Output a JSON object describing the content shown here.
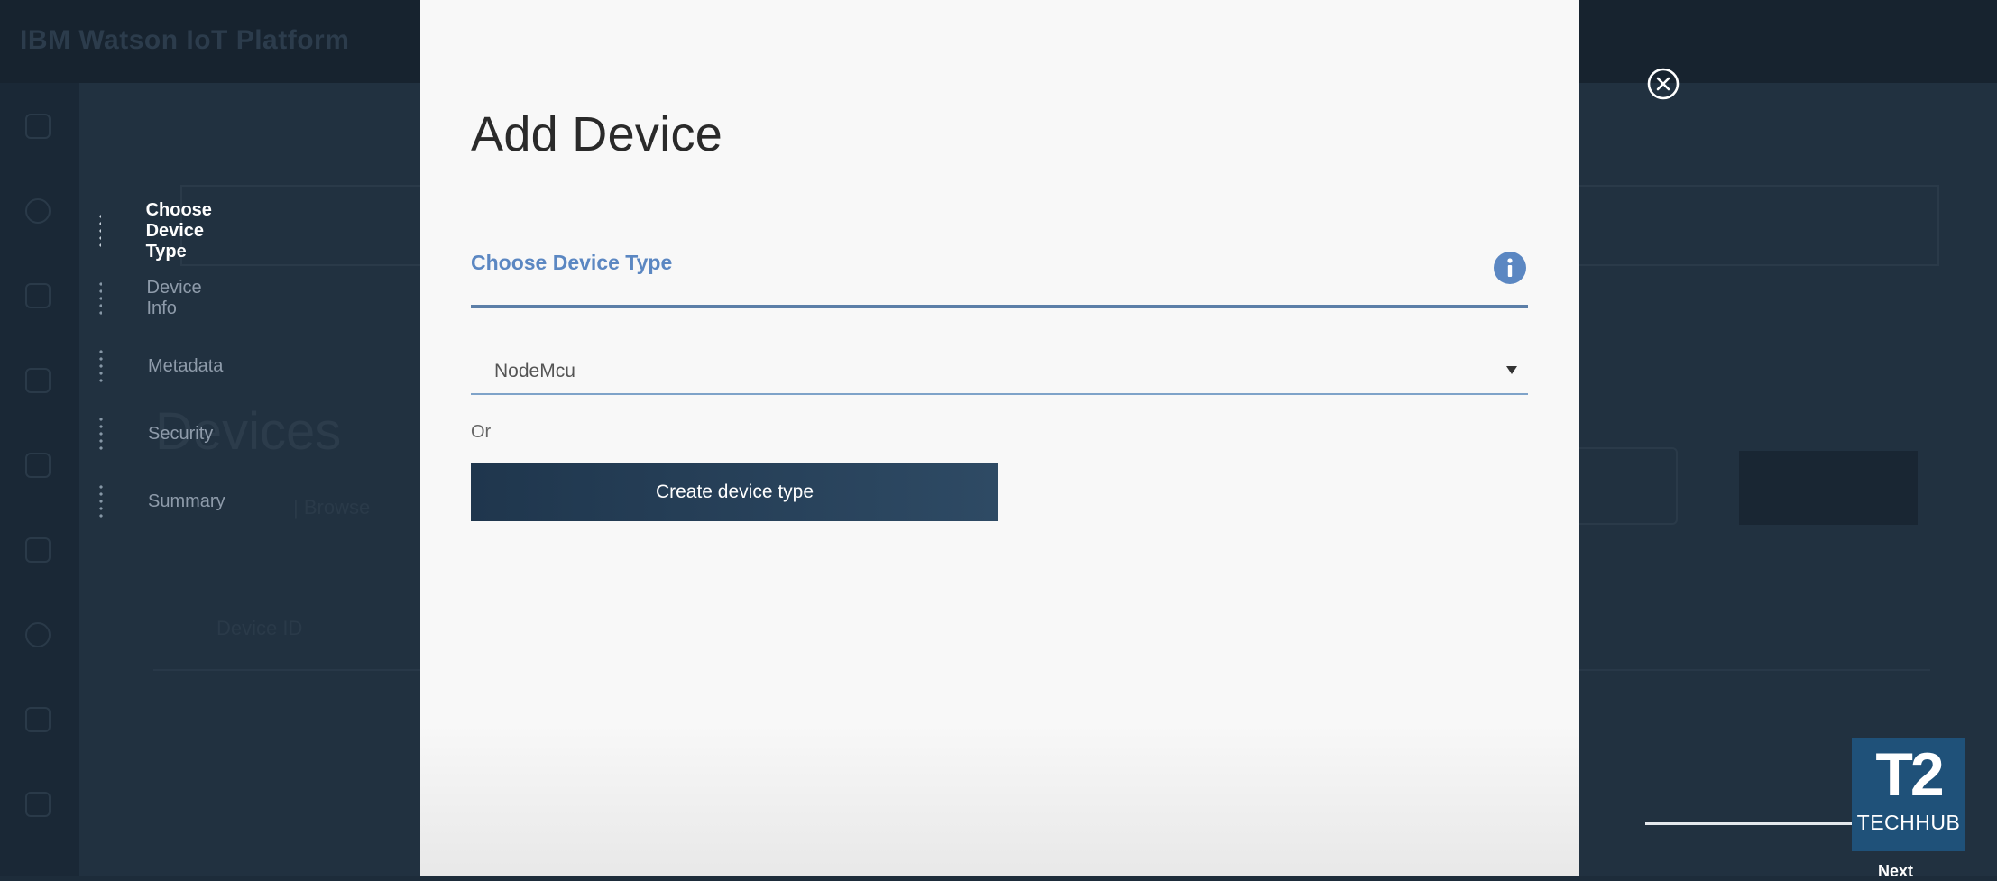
{
  "background": {
    "brand": "IBM Watson IoT Platform",
    "account": [
      "",
      ""
    ],
    "page_title": "Devices",
    "tab": "| Browse",
    "column": "Device ID"
  },
  "wizard_steps": [
    {
      "label": "Choose Device Type",
      "active": true
    },
    {
      "label": "Device Info",
      "active": false
    },
    {
      "label": "Metadata",
      "active": false
    },
    {
      "label": "Security",
      "active": false
    },
    {
      "label": "Summary",
      "active": false
    }
  ],
  "modal": {
    "title": "Add Device",
    "section_title": "Choose Device Type",
    "device_type_select": {
      "value": "NodeMcu"
    },
    "or_label": "Or",
    "create_button": "Create device type"
  },
  "footer": {
    "next_label": "Next"
  },
  "watermark": {
    "big": "T2",
    "small": "TECHHUB"
  },
  "icons": {
    "info": "info-icon",
    "close": "close-circle-icon",
    "caret": "caret-down-icon"
  },
  "colors": {
    "accent": "#5b87c2",
    "button": "#2a445e",
    "modal_bg": "#f8f8f8",
    "overlay": "#1f2f3d"
  }
}
